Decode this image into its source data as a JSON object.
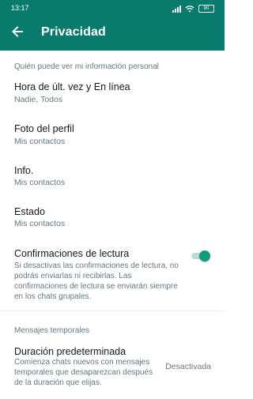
{
  "status_bar": {
    "time": "13:17",
    "battery": "90"
  },
  "header": {
    "title": "Privacidad",
    "back_icon": "arrow-left-icon",
    "color": "#087b6d"
  },
  "sections": {
    "personal_info": {
      "header": "Quién puede ver mi información personal",
      "items": [
        {
          "title": "Hora de últ. vez y En línea",
          "value": "Nadie, Todos"
        },
        {
          "title": "Foto del perfil",
          "value": "Mis contactos"
        },
        {
          "title": "Info.",
          "value": "Mis contactos"
        },
        {
          "title": "Estado",
          "value": "Mis contactos"
        }
      ],
      "read_receipts": {
        "title": "Confirmaciones de lectura",
        "description": "Si desactivas las confirmaciones de lectura, no podrás enviarlas ni recibirlas. Las confirmaciones de lectura se enviarán siempre en los chats grupales.",
        "enabled": true,
        "accent": "#0f9d7e"
      }
    },
    "temporary_messages": {
      "header": "Mensajes temporales",
      "default_duration": {
        "title": "Duración predeterminada",
        "description": "Comienza chats nuevos con mensajes temporales que desaparezcan después de la duración que elijas.",
        "value": "Desactivada"
      }
    }
  }
}
